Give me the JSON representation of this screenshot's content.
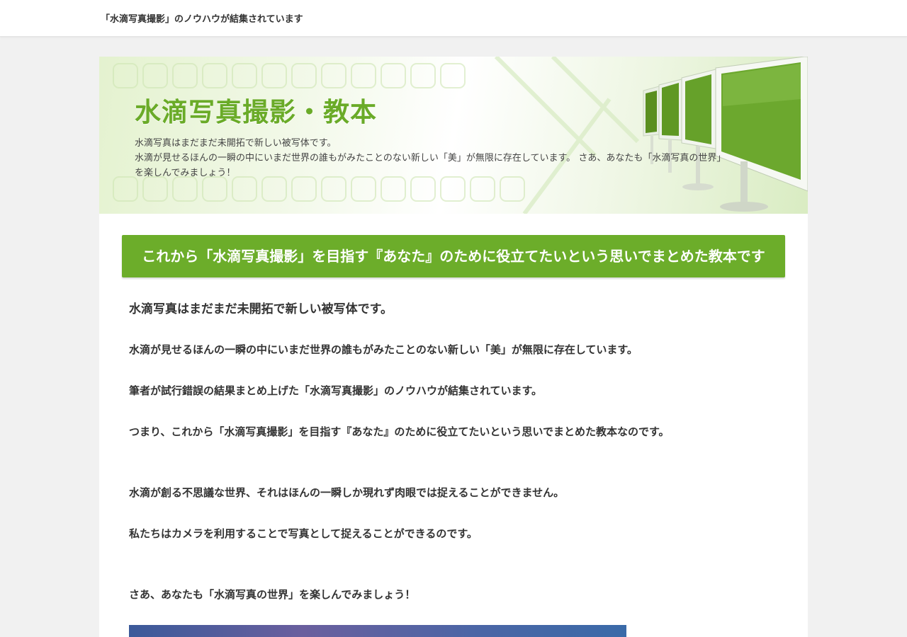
{
  "header": {
    "tagline": "「水滴写真撮影」のノウハウが結集されています"
  },
  "hero": {
    "title": "水滴写真撮影・教本",
    "description": [
      "水滴写真はまだまだ未開拓で新しい被写体です。",
      "水滴が見せるほんの一瞬の中にいまだ世界の誰もがみたことのない新しい「美」が無限に存在しています。 さあ、あなたも「水滴写真の世界」",
      "を楽しんでみましょう！"
    ]
  },
  "content": {
    "headline": "これから「水滴写真撮影」を目指す『あなた』のために役立てたいという思いでまとめた教本です",
    "paragraphs": [
      "水滴写真はまだまだ未開拓で新しい被写体です。",
      "水滴が見せるほんの一瞬の中にいまだ世界の誰もがみたことのない新しい「美」が無限に存在しています。",
      "筆者が試行錯誤の結果まとめ上げた「水滴写真撮影」のノウハウが結集されています。",
      "つまり、これから「水滴写真撮影」を目指す『あなた』のために役立てたいという思いでまとめた教本なのです。",
      "水滴が創る不思議な世界、それはほんの一瞬しか現れず肉眼では捉えることができません。",
      "私たちはカメラを利用することで写真として捉えることができるのです。",
      "さあ、あなたも「水滴写真の世界」を楽しんでみましょう！"
    ]
  },
  "colors": {
    "accent": "#6cad2a",
    "title_green": "#6aab28",
    "page_bg": "#f1f1f1"
  }
}
